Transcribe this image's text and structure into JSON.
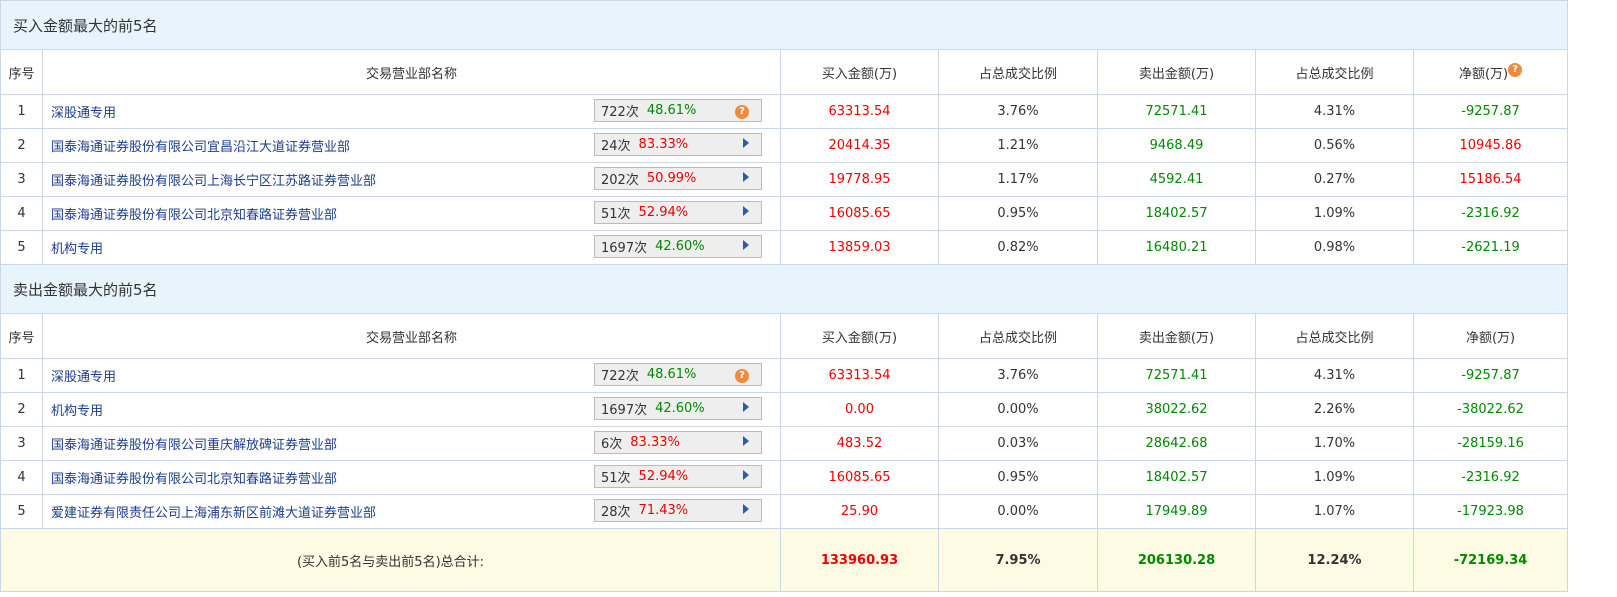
{
  "headers": {
    "seq": "序号",
    "name": "交易营业部名称",
    "buy": "买入金额(万)",
    "buy_ratio": "占总成交比例",
    "sell": "卖出金额(万)",
    "sell_ratio": "占总成交比例",
    "net": "净额(万)"
  },
  "buy_section": {
    "title": "买入金额最大的前5名",
    "rows": [
      {
        "seq": "1",
        "name": "深股通专用",
        "count": "722次",
        "pct": "48.61%",
        "pct_color": "green",
        "icon": "question",
        "buy": "63313.54",
        "buy_ratio": "3.76%",
        "sell": "72571.41",
        "sell_ratio": "4.31%",
        "net": "-9257.87",
        "net_color": "green"
      },
      {
        "seq": "2",
        "name": "国泰海通证券股份有限公司宜昌沿江大道证券营业部",
        "count": "24次",
        "pct": "83.33%",
        "pct_color": "red",
        "icon": "arrow",
        "buy": "20414.35",
        "buy_ratio": "1.21%",
        "sell": "9468.49",
        "sell_ratio": "0.56%",
        "net": "10945.86",
        "net_color": "red"
      },
      {
        "seq": "3",
        "name": "国泰海通证券股份有限公司上海长宁区江苏路证券营业部",
        "count": "202次",
        "pct": "50.99%",
        "pct_color": "red",
        "icon": "arrow",
        "buy": "19778.95",
        "buy_ratio": "1.17%",
        "sell": "4592.41",
        "sell_ratio": "0.27%",
        "net": "15186.54",
        "net_color": "red"
      },
      {
        "seq": "4",
        "name": "国泰海通证券股份有限公司北京知春路证券营业部",
        "count": "51次",
        "pct": "52.94%",
        "pct_color": "red",
        "icon": "arrow",
        "buy": "16085.65",
        "buy_ratio": "0.95%",
        "sell": "18402.57",
        "sell_ratio": "1.09%",
        "net": "-2316.92",
        "net_color": "green"
      },
      {
        "seq": "5",
        "name": "机构专用",
        "count": "1697次",
        "pct": "42.60%",
        "pct_color": "green",
        "icon": "arrow",
        "buy": "13859.03",
        "buy_ratio": "0.82%",
        "sell": "16480.21",
        "sell_ratio": "0.98%",
        "net": "-2621.19",
        "net_color": "green"
      }
    ]
  },
  "sell_section": {
    "title": "卖出金额最大的前5名",
    "rows": [
      {
        "seq": "1",
        "name": "深股通专用",
        "count": "722次",
        "pct": "48.61%",
        "pct_color": "green",
        "icon": "question",
        "buy": "63313.54",
        "buy_ratio": "3.76%",
        "sell": "72571.41",
        "sell_ratio": "4.31%",
        "net": "-9257.87",
        "net_color": "green"
      },
      {
        "seq": "2",
        "name": "机构专用",
        "count": "1697次",
        "pct": "42.60%",
        "pct_color": "green",
        "icon": "arrow",
        "buy": "0.00",
        "buy_ratio": "0.00%",
        "sell": "38022.62",
        "sell_ratio": "2.26%",
        "net": "-38022.62",
        "net_color": "green"
      },
      {
        "seq": "3",
        "name": "国泰海通证券股份有限公司重庆解放碑证券营业部",
        "count": "6次",
        "pct": "83.33%",
        "pct_color": "red",
        "icon": "arrow",
        "buy": "483.52",
        "buy_ratio": "0.03%",
        "sell": "28642.68",
        "sell_ratio": "1.70%",
        "net": "-28159.16",
        "net_color": "green"
      },
      {
        "seq": "4",
        "name": "国泰海通证券股份有限公司北京知春路证券营业部",
        "count": "51次",
        "pct": "52.94%",
        "pct_color": "red",
        "icon": "arrow",
        "buy": "16085.65",
        "buy_ratio": "0.95%",
        "sell": "18402.57",
        "sell_ratio": "1.09%",
        "net": "-2316.92",
        "net_color": "green"
      },
      {
        "seq": "5",
        "name": "爱建证券有限责任公司上海浦东新区前滩大道证券营业部",
        "count": "28次",
        "pct": "71.43%",
        "pct_color": "red",
        "icon": "arrow",
        "buy": "25.90",
        "buy_ratio": "0.00%",
        "sell": "17949.89",
        "sell_ratio": "1.07%",
        "net": "-17923.98",
        "net_color": "green"
      }
    ]
  },
  "total": {
    "label": "(买入前5名与卖出前5名)总合计:",
    "buy": "133960.93",
    "buy_ratio": "7.95%",
    "sell": "206130.28",
    "sell_ratio": "12.24%",
    "net": "-72169.34"
  },
  "colors": {
    "red": "#ee0000",
    "green": "#008800",
    "header_bg": "#e8f4fc",
    "total_bg": "#fdfbe3"
  }
}
